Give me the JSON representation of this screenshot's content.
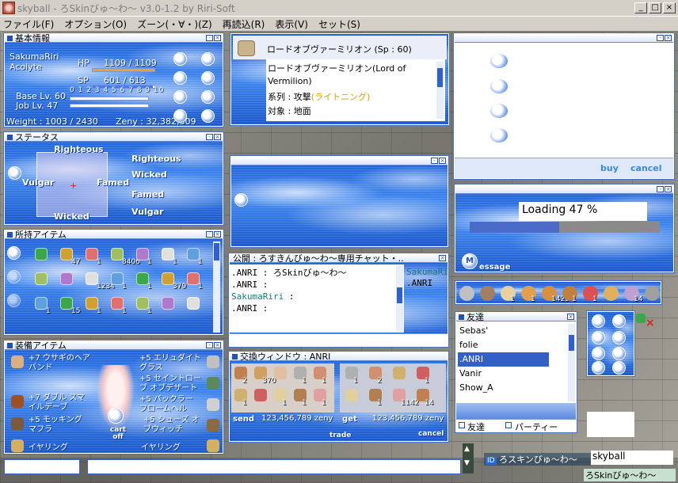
{
  "app": {
    "title": "skyball - ろSkinびゅ〜わ〜 v3.0-1.2 by Riri-Soft",
    "buttons": [
      "_",
      "□",
      "×"
    ]
  },
  "menu": [
    "ファイル(F)",
    "オプション(O)",
    "ズーン(・∀・)(Z)",
    "再読込(R)",
    "表示(V)",
    "セット(S)"
  ],
  "basic": {
    "title": "基本情報",
    "name": "SakumaRiri",
    "job": "Acolyte",
    "hp_label": "HP",
    "hp": "1109 / 1109",
    "hp_fraction": 1.0,
    "sp_label": "SP",
    "sp": "601 / 613",
    "sp_fraction": 0.98,
    "scale": "0 1 2 3 4 5 6 7 8 9 10",
    "base_lv": "Base Lv. 60",
    "job_lv": "Job Lv. 47",
    "weight": "Weight : 1003 / 2430",
    "zeny": "Zeny : 32,382,309"
  },
  "skill": {
    "title": "ロードオブヴァーミリオン (Sp : 60)",
    "desc1": "ロードオブヴァーミリオン(Lord of",
    "desc2": "Vermilion)",
    "kind_label": "系列 : 攻撃",
    "kind_value": "(ライトニング)",
    "target": "対象 : 地面"
  },
  "shop": {
    "buy": "buy",
    "cancel": "cancel"
  },
  "status": {
    "title": "ステータス",
    "labels": [
      "Righteous",
      "Vulgar",
      "Famed",
      "Wicked",
      "Righteous",
      "Wicked",
      "Famed",
      "Vulgar"
    ]
  },
  "loading": {
    "text": "Loading 47 %",
    "progress": 0.47,
    "message": "essage",
    "message_icon": "M"
  },
  "items": {
    "title": "所持アイテム",
    "qty_rows": [
      [
        "",
        "47",
        "1",
        "8406",
        "1",
        "1",
        "1"
      ],
      [
        "",
        "",
        "1234",
        "1",
        "1",
        "379",
        "1"
      ],
      [
        "1",
        "15",
        "1",
        "1",
        "1",
        "",
        ""
      ]
    ],
    "icon_colors": [
      "#3aa84a",
      "#d0a030",
      "#e07070",
      "#a0c060",
      "#b07acc",
      "#e0e0e0",
      "#60a0e0"
    ]
  },
  "chat": {
    "title": "公開 : ろすきんびゅ〜わ〜専用チャット・..",
    "lines": [
      {
        "speaker": ".ANRI",
        "sep": " : ",
        "text": "ろSkinびゅ〜わ〜",
        "speaker_color": "#000000"
      },
      {
        "speaker": ".ANRI",
        "sep": " : ",
        "text": "",
        "speaker_color": "#000000"
      },
      {
        "speaker": "SakumaRiri",
        "sep": " : ",
        "text": "",
        "speaker_color": "#1a7a7a"
      },
      {
        "speaker": ".ANRI",
        "sep": " : ",
        "text": "",
        "speaker_color": "#000000"
      }
    ],
    "members": [
      {
        "name": "SakumaRiri",
        "color": "#1a7a7a"
      },
      {
        "name": ".ANRI",
        "color": "#000000"
      }
    ]
  },
  "hotbar": {
    "qtys": [
      "",
      "",
      "1",
      "1",
      "1423",
      "1",
      "1",
      "",
      "14",
      ""
    ]
  },
  "friends": {
    "title": "友達",
    "list": [
      "Sebas'",
      "folie",
      ".ANRI",
      "Vanir",
      "Show_A"
    ],
    "selected": 2,
    "tab_friend": "友達",
    "tab_party": "パーティー"
  },
  "equip": {
    "title": "装備アイテム",
    "left": [
      "+7 ウサギのヘアバンド",
      "+7 ダブル スマイルデーブ",
      "+5 モッキング マフラ",
      "イヤリング"
    ],
    "right": [
      "+5 エリュダイトグラス",
      "+5 セイントローブ オブデザート",
      "+5 バックラー フロームヘル",
      "+5 シューズ オブウィッチ",
      "イヤリング"
    ],
    "cart": "cart off"
  },
  "trade": {
    "title": "交換ウィンドウ : ANRI",
    "left_qtys": [
      "2",
      "370",
      "",
      "1",
      "1",
      "1",
      "",
      "1",
      "1",
      "1"
    ],
    "right_qtys": [
      "1",
      "2",
      "",
      "1",
      "",
      "1",
      "1142",
      "14"
    ],
    "send": "send",
    "send_zeny": "123,456,789 zeny",
    "get": "get",
    "get_zeny": "123,456,789 zeny",
    "trade": "trade",
    "cancel": "cancel"
  },
  "bottom": {
    "input1": "",
    "input2": "",
    "chat_tag": "ID",
    "chat_name": "ろスキンびゅ〜わ〜",
    "name_box": "skyball",
    "mini_chat": "ろSkinびゅ〜わ〜"
  },
  "colors": {
    "window_blue": "#3e86ee",
    "header": "#dbe6f8",
    "accent": "#2450b8",
    "hp_bar": "#e7a23a"
  }
}
